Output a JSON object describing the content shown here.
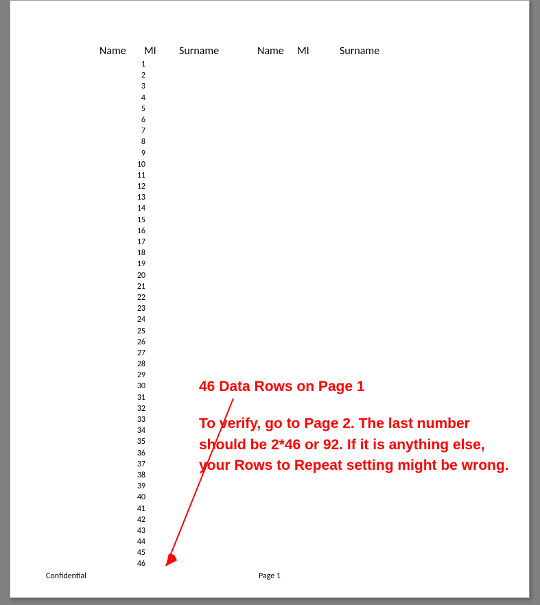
{
  "headers": {
    "name1": "Name",
    "mi1": "MI",
    "surname1": "Surname",
    "name2": "Name",
    "mi2": "MI",
    "surname2": "Surname"
  },
  "rows": [
    "1",
    "2",
    "3",
    "4",
    "5",
    "6",
    "7",
    "8",
    "9",
    "10",
    "11",
    "12",
    "13",
    "14",
    "15",
    "16",
    "17",
    "18",
    "19",
    "20",
    "21",
    "22",
    "23",
    "24",
    "25",
    "26",
    "27",
    "28",
    "29",
    "30",
    "31",
    "32",
    "33",
    "34",
    "35",
    "36",
    "37",
    "38",
    "39",
    "40",
    "41",
    "42",
    "43",
    "44",
    "45",
    "46"
  ],
  "footer": {
    "left": "Confidential",
    "center": "Page 1"
  },
  "annotation": {
    "line1": "46 Data Rows on Page 1",
    "line2": "To verify, go to Page 2. The last number should be 2*46 or 92. If it is anything else, your Rows to Repeat setting might be wrong."
  }
}
